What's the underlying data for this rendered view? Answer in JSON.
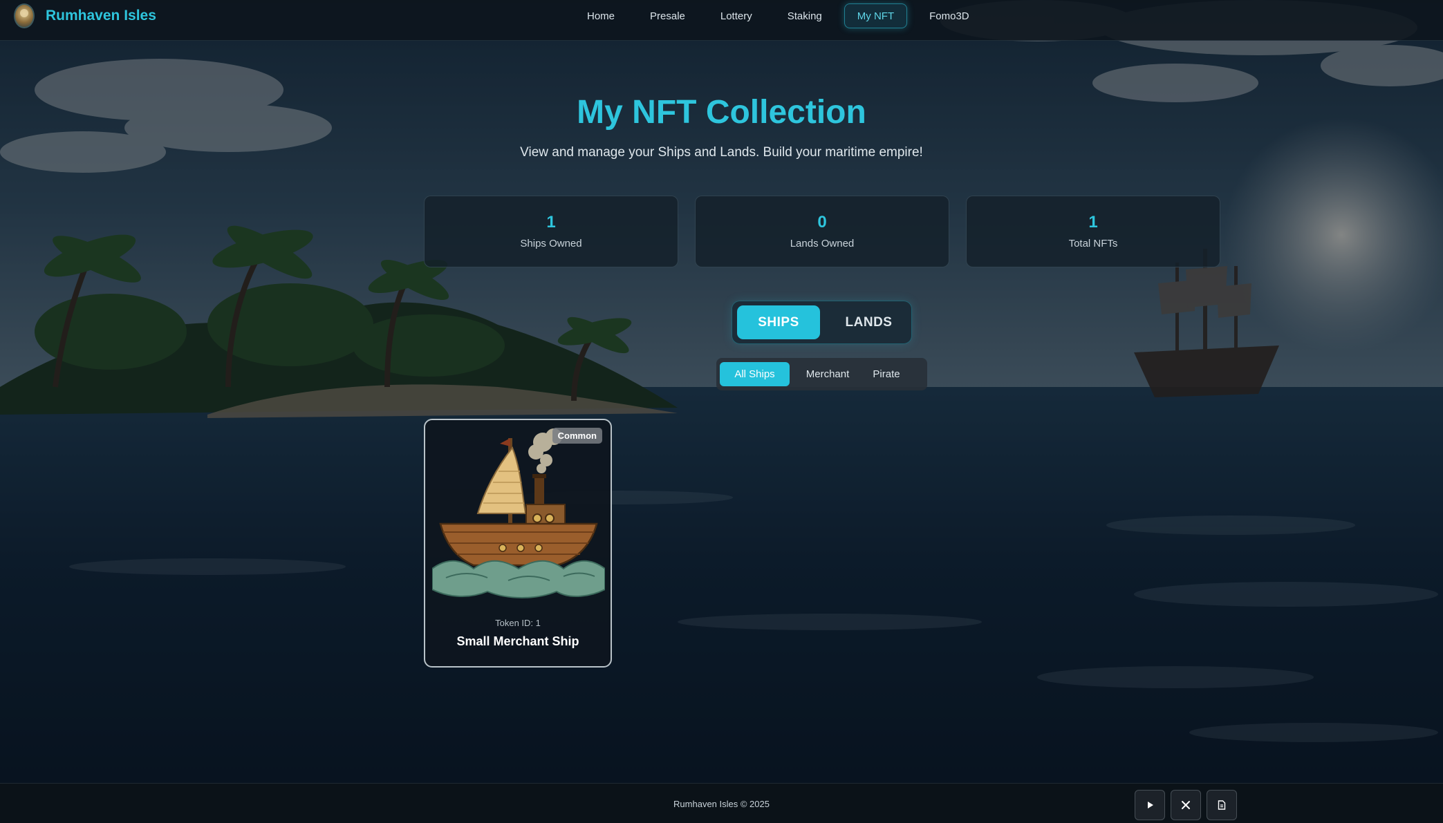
{
  "brand": {
    "name": "Rumhaven Isles",
    "logo_icon": "pirate-emblem-icon"
  },
  "nav": {
    "links": [
      {
        "label": "Home",
        "active": false
      },
      {
        "label": "Presale",
        "active": false
      },
      {
        "label": "Lottery",
        "active": false
      },
      {
        "label": "Staking",
        "active": false
      },
      {
        "label": "My NFT",
        "active": true
      },
      {
        "label": "Fomo3D",
        "active": false
      }
    ]
  },
  "header": {
    "title": "My NFT Collection",
    "subtitle": "View and manage your Ships and Lands. Build your maritime empire!"
  },
  "stats": [
    {
      "value": "1",
      "label": "Ships Owned"
    },
    {
      "value": "0",
      "label": "Lands Owned"
    },
    {
      "value": "1",
      "label": "Total NFTs"
    }
  ],
  "type_toggle": {
    "ships_label": "SHIPS",
    "lands_label": "LANDS",
    "selected": "SHIPS"
  },
  "filters": {
    "all": "All Ships",
    "merchant": "Merchant",
    "pirate": "Pirate",
    "selected": "All Ships"
  },
  "nfts": [
    {
      "rarity": "Common",
      "token_id": "Token ID: 1",
      "name": "Small Merchant Ship",
      "image_icon": "merchant-ship-icon"
    }
  ],
  "footer": {
    "copyright": "Rumhaven Isles © 2025",
    "buttons": [
      "play-icon",
      "x-icon",
      "document-icon"
    ]
  },
  "colors": {
    "accent": "#2ec5dd",
    "accent_button": "#25c2dc",
    "background": "#0b1620"
  }
}
